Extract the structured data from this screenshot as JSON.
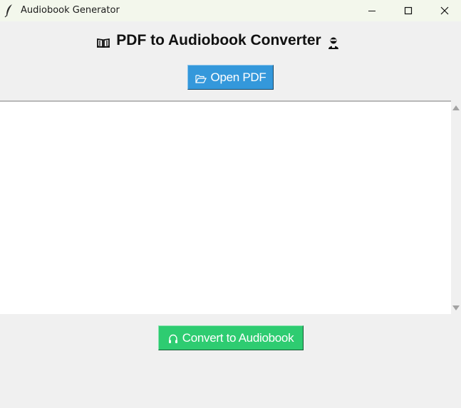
{
  "window": {
    "title": "Audiobook Generator",
    "icon": "feather-icon",
    "controls": [
      "minimize-icon",
      "maximize-icon",
      "close-icon"
    ]
  },
  "main": {
    "heading": "PDF to Audiobook Converter",
    "heading_left_icon": "open-book-icon",
    "heading_right_icon": "speaker-person-icon",
    "open_button": {
      "label": "Open PDF",
      "icon": "folder-open-icon",
      "color": "#3498db"
    },
    "text_area": {
      "value": ""
    },
    "convert_button": {
      "label": "Convert to Audiobook",
      "icon": "headphones-icon",
      "color": "#2ecc71"
    }
  },
  "colors": {
    "background": "#f0f0f0",
    "titlebar": "#f3f7ec",
    "text_area_bg": "#ffffff"
  }
}
